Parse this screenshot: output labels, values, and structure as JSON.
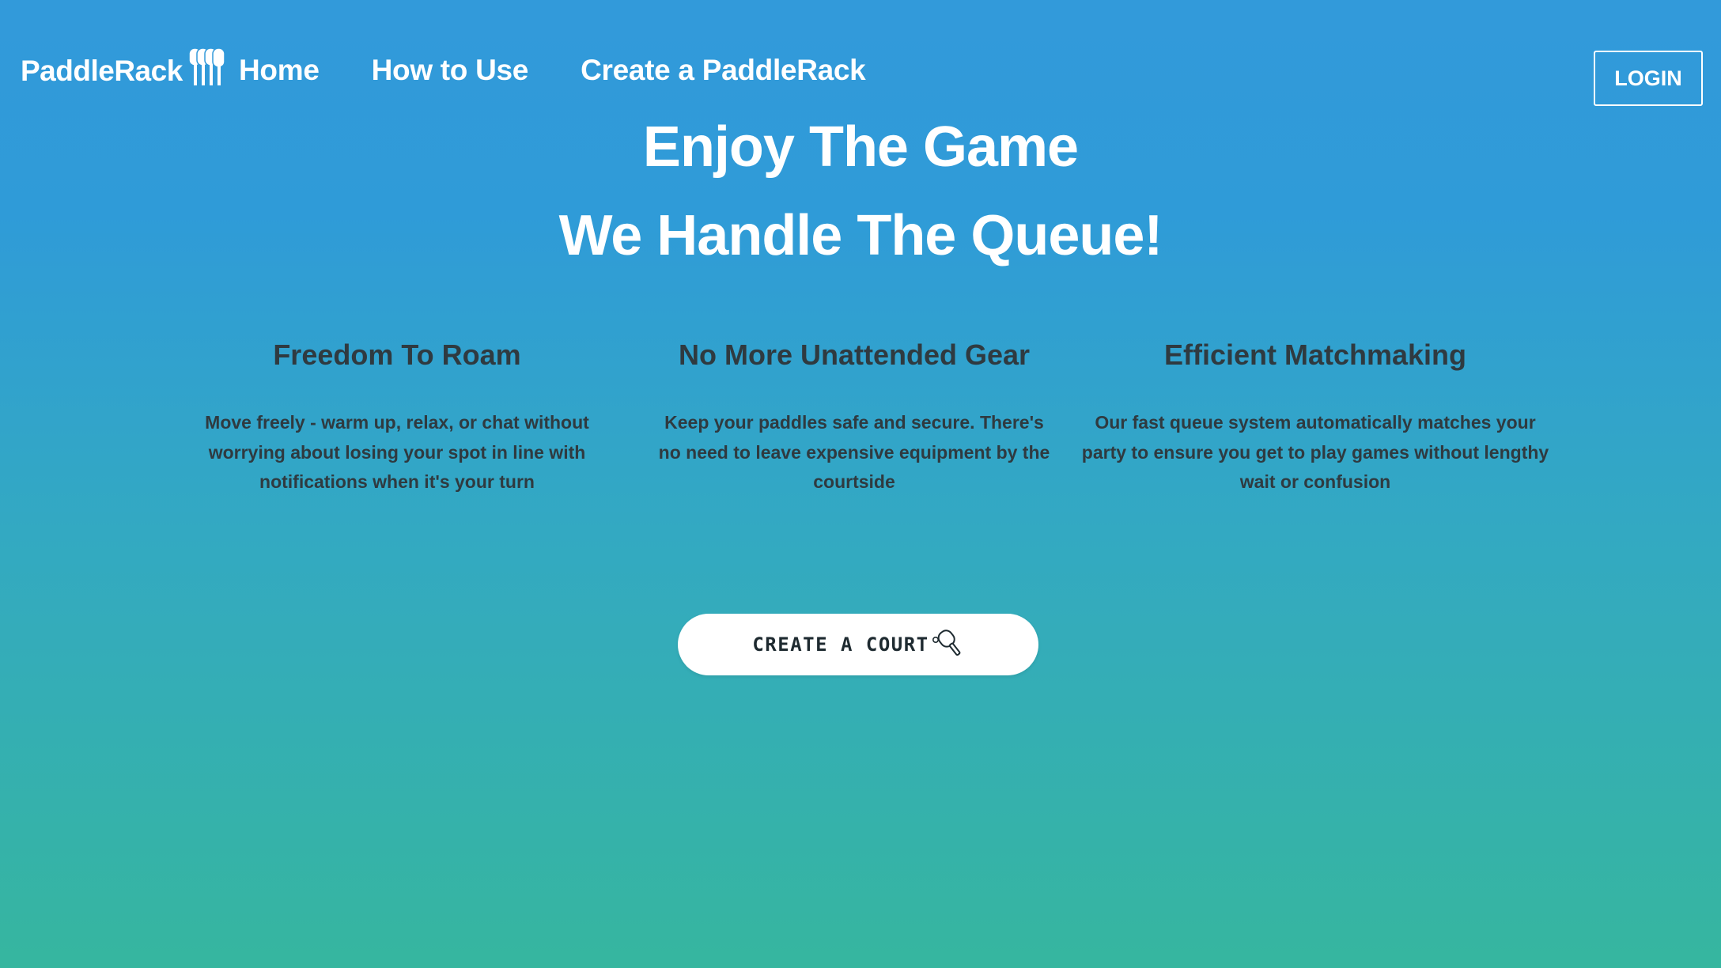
{
  "nav": {
    "brand": "PaddleRack",
    "brand_icon": "paddle-rack-logo-icon",
    "links": [
      {
        "label": "Home"
      },
      {
        "label": "How to Use"
      },
      {
        "label": "Create a PaddleRack"
      }
    ],
    "login_label": "LOGIN"
  },
  "hero": {
    "line1": "Enjoy The Game",
    "line2": "We Handle The Queue!"
  },
  "features": [
    {
      "title": "Freedom To Roam",
      "description": "Move freely - warm up, relax, or chat without worrying about losing your spot in line with notifications when it's your turn"
    },
    {
      "title": "No More Unattended Gear",
      "description": "Keep your paddles safe and secure. There's no need to leave expensive equipment by the courtside"
    },
    {
      "title": "Efficient Matchmaking",
      "description": "Our fast queue system automatically matches your party to ensure you get to play games without lengthy wait or confusion"
    }
  ],
  "cta": {
    "label": "CREATE A COURT",
    "icon": "pickleball-paddle-icon"
  },
  "colors": {
    "gradient_top": "#329ada",
    "gradient_bottom": "#36b69f",
    "feature_text": "#2f3a40",
    "button_bg": "#ffffff"
  }
}
